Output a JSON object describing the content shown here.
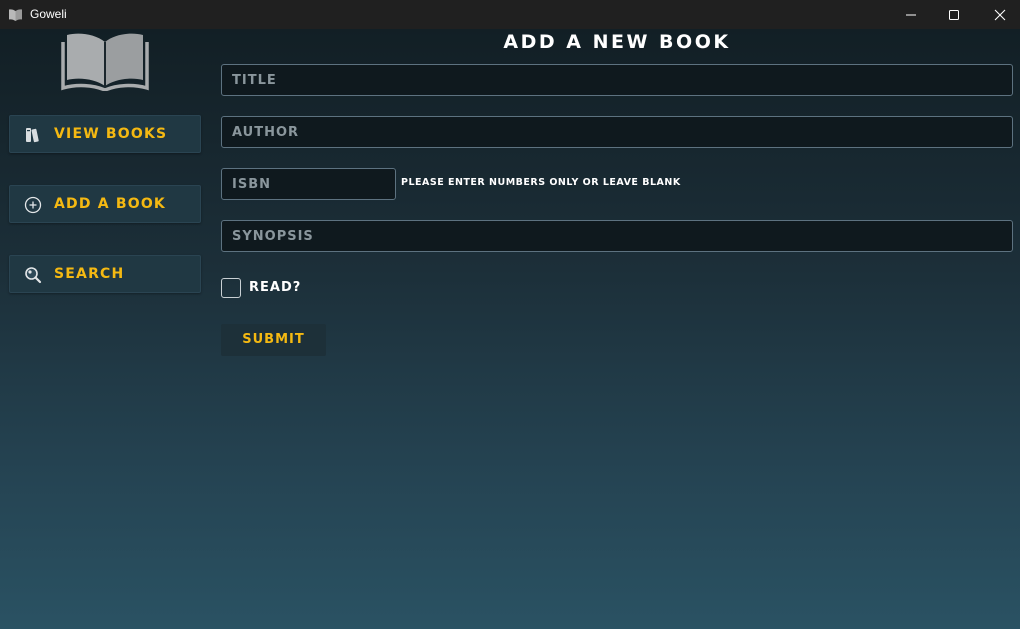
{
  "window": {
    "title": "Goweli",
    "icon": "open-book-icon",
    "controls": [
      "minimize-icon",
      "maximize-icon",
      "close-icon"
    ]
  },
  "colors": {
    "accent": "#f5b912",
    "titlebar": "#202020",
    "nav_button_bg": "#203843",
    "input_bg": "#0f191e",
    "gradient_top": "#121f25",
    "gradient_bottom": "#2a5263"
  },
  "sidebar": {
    "logo": "open-book-icon",
    "items": [
      {
        "label": "VIEW BOOKS",
        "icon": "books-icon"
      },
      {
        "label": "ADD A BOOK",
        "icon": "add-circle-icon"
      },
      {
        "label": "SEARCH",
        "icon": "search-icon"
      }
    ]
  },
  "main": {
    "title": "ADD A NEW BOOK",
    "form": {
      "title_placeholder": "TITLE",
      "author_placeholder": "AUTHOR",
      "isbn_placeholder": "ISBN",
      "isbn_hint": "PLEASE ENTER NUMBERS ONLY OR LEAVE BLANK",
      "synopsis_placeholder": "SYNOPSIS",
      "read_label": "READ?",
      "read_checked": false,
      "submit_label": "SUBMIT"
    }
  }
}
